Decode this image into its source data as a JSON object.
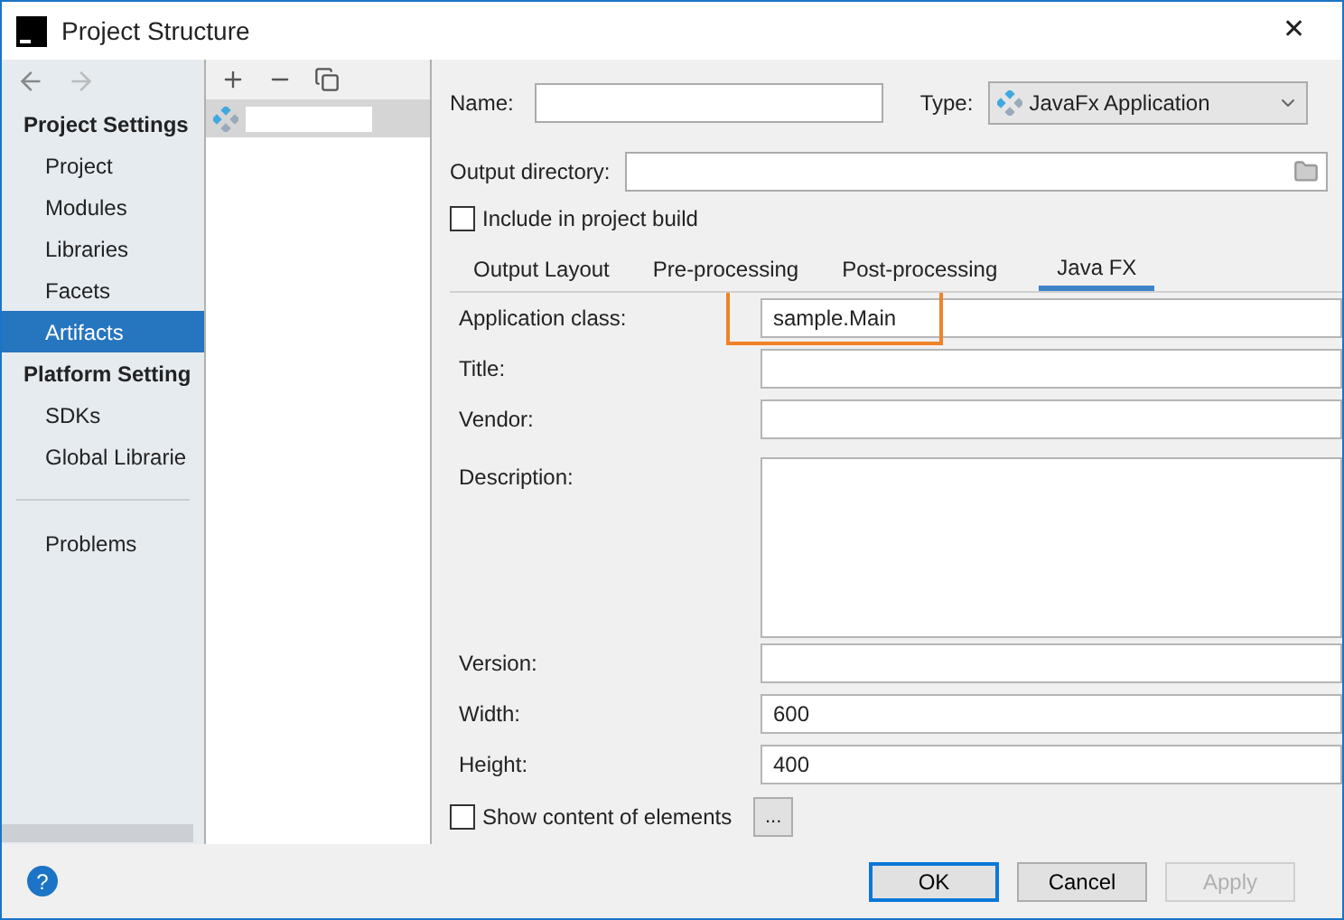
{
  "window": {
    "title": "Project Structure",
    "close": "✕"
  },
  "sidebar": {
    "sections": [
      {
        "title": "Project Settings",
        "items": [
          {
            "label": "Project",
            "selected": false
          },
          {
            "label": "Modules",
            "selected": false
          },
          {
            "label": "Libraries",
            "selected": false
          },
          {
            "label": "Facets",
            "selected": false
          },
          {
            "label": "Artifacts",
            "selected": true
          }
        ]
      },
      {
        "title": "Platform Setting",
        "items": [
          {
            "label": "SDKs",
            "selected": false
          },
          {
            "label": "Global Librarie",
            "selected": false
          }
        ]
      }
    ],
    "footer_items": [
      {
        "label": "Problems",
        "selected": false
      }
    ]
  },
  "artifact_list": {
    "items": [
      {
        "selected": true
      }
    ]
  },
  "form": {
    "name": {
      "label": "Name:"
    },
    "type": {
      "label": "Type:",
      "value": "JavaFx Application"
    },
    "output_directory": {
      "label": "Output directory:"
    },
    "include_in_build": {
      "label": "Include in project build",
      "checked": false
    }
  },
  "tabs": [
    {
      "label": "Output Layout",
      "selected": false
    },
    {
      "label": "Pre-processing",
      "selected": false
    },
    {
      "label": "Post-processing",
      "selected": false
    },
    {
      "label": "Java FX",
      "selected": true
    }
  ],
  "javafx_fields": [
    {
      "label": "Application class:",
      "value": "sample.Main",
      "kind": "highlighted"
    },
    {
      "label": "Title:",
      "kind": "text"
    },
    {
      "label": "Vendor:",
      "kind": "text"
    },
    {
      "label": "Description:",
      "kind": "multiline"
    },
    {
      "label": "Version:",
      "kind": "text"
    },
    {
      "label": "Width:",
      "value": "600",
      "kind": "text"
    },
    {
      "label": "Height:",
      "value": "400",
      "kind": "text"
    }
  ],
  "show_content": {
    "label": "Show content of elements",
    "checked": false,
    "button": "..."
  },
  "help": "?",
  "buttons": [
    {
      "label": "OK",
      "kind": "default"
    },
    {
      "label": "Cancel",
      "kind": "normal"
    },
    {
      "label": "Apply",
      "kind": "disabled"
    }
  ]
}
